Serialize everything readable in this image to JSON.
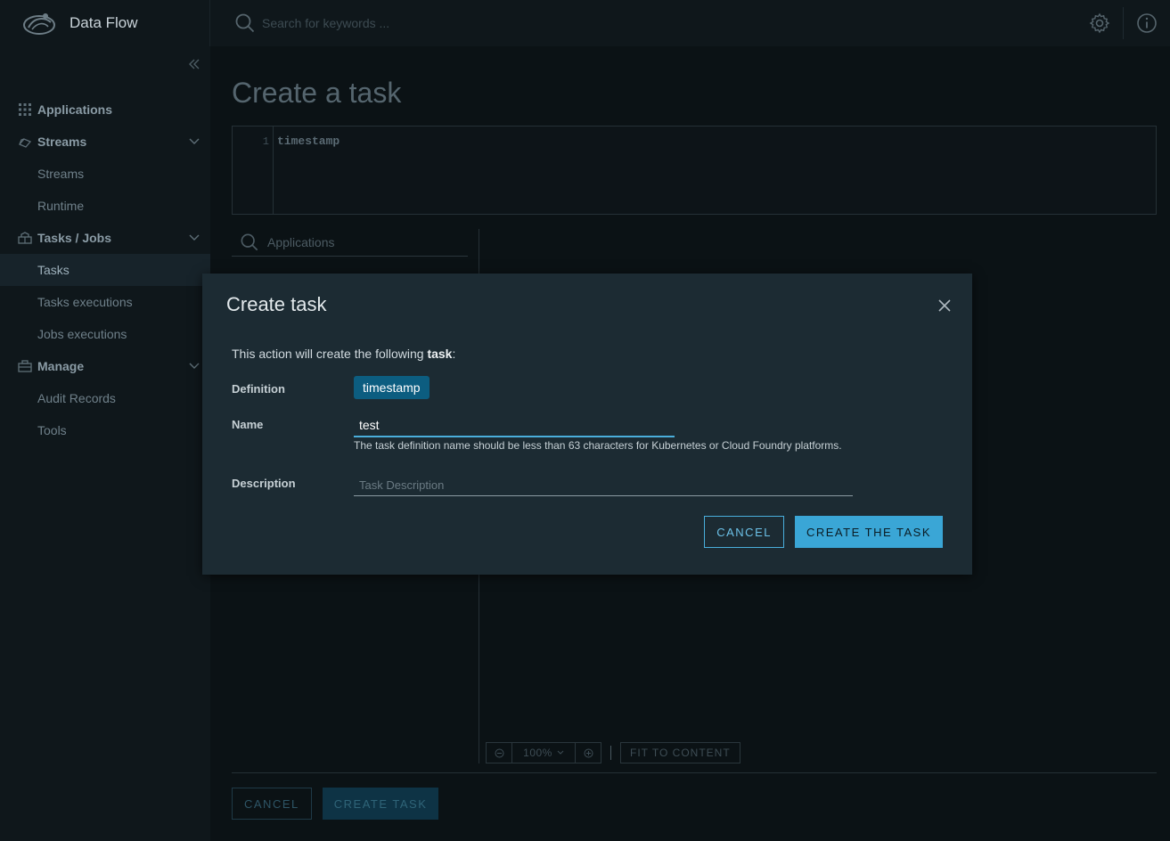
{
  "header": {
    "app_name": "Data Flow",
    "search_placeholder": "Search for keywords ...",
    "settings_icon": "gear-icon",
    "info_icon": "info-icon"
  },
  "sidebar": {
    "items": [
      {
        "label": "Applications",
        "type": "link",
        "icon": "grid-icon"
      },
      {
        "label": "Streams",
        "type": "group",
        "icon": "streams-icon",
        "expanded": true
      },
      {
        "label": "Streams",
        "type": "sub"
      },
      {
        "label": "Runtime",
        "type": "sub"
      },
      {
        "label": "Tasks / Jobs",
        "type": "group",
        "icon": "tasks-icon",
        "expanded": true
      },
      {
        "label": "Tasks",
        "type": "sub",
        "active": true
      },
      {
        "label": "Tasks executions",
        "type": "sub"
      },
      {
        "label": "Jobs executions",
        "type": "sub"
      },
      {
        "label": "Manage",
        "type": "group",
        "icon": "briefcase-icon",
        "expanded": true
      },
      {
        "label": "Audit Records",
        "type": "sub"
      },
      {
        "label": "Tools",
        "type": "sub"
      }
    ]
  },
  "main": {
    "title": "Create a task",
    "editor": {
      "line_number": "1",
      "code": "timestamp"
    },
    "palette_placeholder": "Applications",
    "toolbar": {
      "zoom_level": "100%",
      "fit_label": "FIT TO CONTENT"
    },
    "footer": {
      "cancel_label": "CANCEL",
      "create_label": "CREATE TASK"
    }
  },
  "modal": {
    "title": "Create task",
    "intro_prefix": "This action will create the following ",
    "intro_bold": "task",
    "intro_suffix": ":",
    "definition_label": "Definition",
    "definition_value": "timestamp",
    "name_label": "Name",
    "name_value": "test",
    "name_help": "The task definition name should be less than 63 characters for Kubernetes or Cloud Foundry platforms.",
    "description_label": "Description",
    "description_placeholder": "Task Description",
    "cancel_label": "CANCEL",
    "create_label": "CREATE THE TASK"
  },
  "colors": {
    "accent": "#3aa6d6",
    "badge": "#0c5d80",
    "modal_bg": "#1c2b33",
    "page_bg": "#0b1215"
  }
}
